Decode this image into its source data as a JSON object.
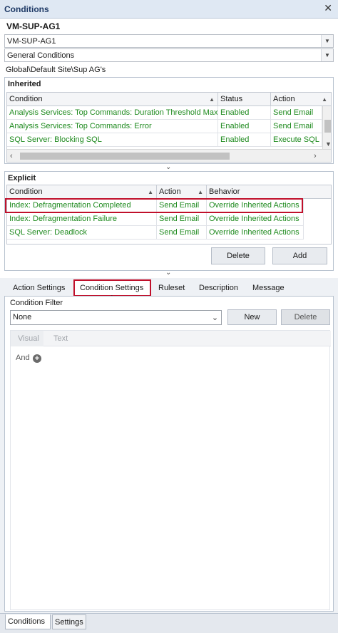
{
  "panel": {
    "title": "Conditions",
    "close_glyph": "✕"
  },
  "server": {
    "name": "VM-SUP-AG1"
  },
  "combo_server": {
    "value": "VM-SUP-AG1"
  },
  "combo_conditions": {
    "value": "General Conditions"
  },
  "path": "Global\\Default Site\\Sup AG's",
  "inherited": {
    "title": "Inherited",
    "columns": [
      "Condition",
      "Status",
      "Action"
    ],
    "rows": [
      [
        "Analysis Services: Top Commands: Duration Threshold Max",
        "Enabled",
        "Send Email"
      ],
      [
        "Analysis Services: Top Commands: Error",
        "Enabled",
        "Send Email"
      ],
      [
        "SQL Server: Blocking SQL",
        "Enabled",
        "Execute SQL"
      ]
    ]
  },
  "explicit": {
    "title": "Explicit",
    "columns": [
      "Condition",
      "Action",
      "Behavior"
    ],
    "rows": [
      [
        "Index: Defragmentation Completed",
        "Send Email",
        "Override Inherited Actions"
      ],
      [
        "Index: Defragmentation Failure",
        "Send Email",
        "Override Inherited Actions"
      ],
      [
        "SQL Server: Deadlock",
        "Send Email",
        "Override Inherited Actions"
      ]
    ],
    "delete_label": "Delete",
    "add_label": "Add"
  },
  "tabs": [
    "Action Settings",
    "Condition Settings",
    "Ruleset",
    "Description",
    "Message"
  ],
  "condition_settings": {
    "filter_label": "Condition Filter",
    "filter_value": "None",
    "new_label": "New",
    "delete_label": "Delete",
    "subtabs": [
      "Visual",
      "Text"
    ],
    "and_label": "And"
  },
  "bottom_tabs": [
    "Conditions",
    "Settings"
  ],
  "colors": {
    "green_text": "#1e8a1e",
    "highlight": "#c0102b",
    "header_blue": "#1f3a66"
  }
}
